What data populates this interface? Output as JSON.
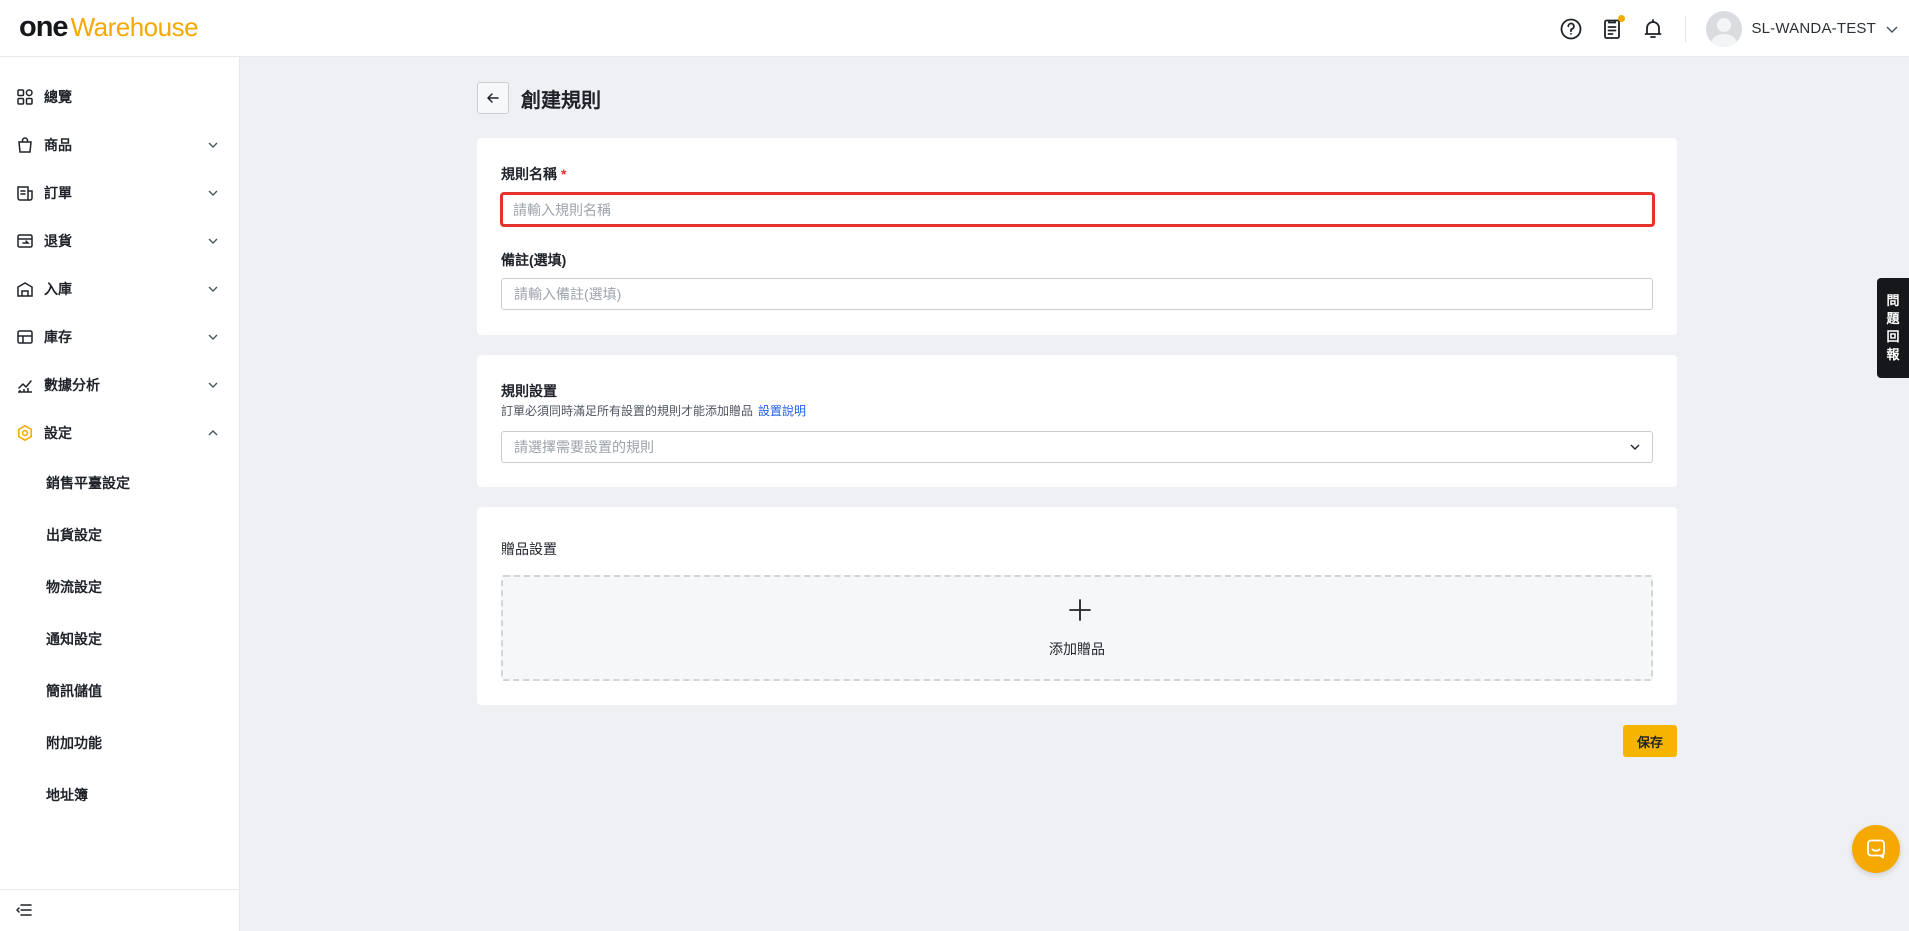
{
  "app": {
    "logo_one": "one",
    "logo_warehouse": "Warehouse",
    "brand_color": "#f5a800"
  },
  "header": {
    "icons": [
      "help-icon",
      "clipboard-icon",
      "bell-icon"
    ],
    "user_name": "SL-WANDA-TEST"
  },
  "sidebar": {
    "items": [
      {
        "label": "總覽",
        "icon": "dashboard-icon"
      },
      {
        "label": "商品",
        "icon": "product-icon"
      },
      {
        "label": "訂單",
        "icon": "order-icon"
      },
      {
        "label": "退貨",
        "icon": "return-icon"
      },
      {
        "label": "入庫",
        "icon": "inbound-icon"
      },
      {
        "label": "庫存",
        "icon": "inventory-icon"
      },
      {
        "label": "數據分析",
        "icon": "analytics-icon"
      },
      {
        "label": "設定",
        "icon": "settings-icon"
      }
    ],
    "settings_sub": [
      {
        "label": "銷售平臺設定"
      },
      {
        "label": "出貨設定"
      },
      {
        "label": "物流設定"
      },
      {
        "label": "通知設定"
      },
      {
        "label": "簡訊儲值"
      },
      {
        "label": "附加功能"
      },
      {
        "label": "地址簿"
      }
    ]
  },
  "page": {
    "title": "創建規則"
  },
  "form": {
    "rule_name_label": "規則名稱",
    "required_mark": "*",
    "rule_name_placeholder": "請輸入規則名稱",
    "rule_name_value": "",
    "note_label": "備註(選填)",
    "note_placeholder": "請輸入備註(選填)",
    "rule_settings_label": "規則設置",
    "rule_settings_desc": "訂單必須同時滿足所有設置的規則才能添加贈品",
    "rule_settings_link": "設置說明",
    "rule_select_placeholder": "請選擇需要設置的規則",
    "gift_settings_label": "贈品設置",
    "add_gift_label": "添加贈品",
    "save_label": "保存",
    "error_color": "#e5332b"
  },
  "feedback": {
    "chars": [
      "問",
      "題",
      "回",
      "報"
    ]
  }
}
